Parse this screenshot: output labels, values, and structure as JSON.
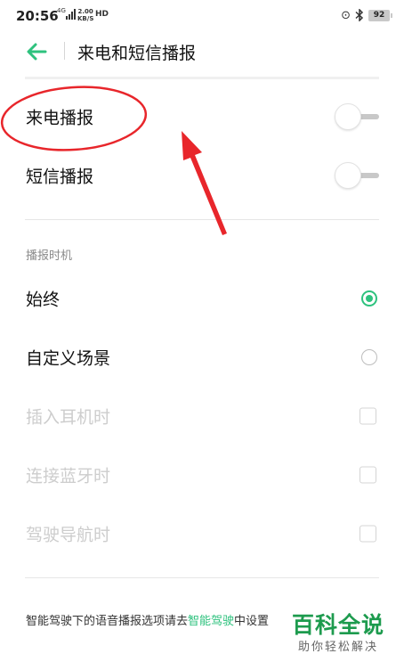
{
  "status_bar": {
    "time": "20:56",
    "network": "4G",
    "speed_value": "2.00",
    "speed_unit": "KB/S",
    "hd": "HD",
    "battery": "92"
  },
  "header": {
    "title": "来电和短信播报",
    "back_icon": "back-arrow-icon",
    "accent_color": "#2ec27e"
  },
  "broadcast": {
    "call_label": "来电播报",
    "call_enabled": false,
    "sms_label": "短信播报",
    "sms_enabled": false
  },
  "timing": {
    "section_title": "播报时机",
    "options": [
      {
        "label": "始终",
        "selected": true
      },
      {
        "label": "自定义场景",
        "selected": false
      }
    ],
    "scenes": [
      {
        "label": "插入耳机时",
        "checked": false,
        "enabled": false
      },
      {
        "label": "连接蓝牙时",
        "checked": false,
        "enabled": false
      },
      {
        "label": "驾驶导航时",
        "checked": false,
        "enabled": false
      }
    ]
  },
  "footer": {
    "note_prefix": "智能驾驶下的语音播报选项请去",
    "note_link": "智能驾驶",
    "note_suffix": "中设置"
  },
  "watermark": {
    "main": "百科全说",
    "sub": "助你轻松解决"
  },
  "annotation_color": "#e8262b"
}
